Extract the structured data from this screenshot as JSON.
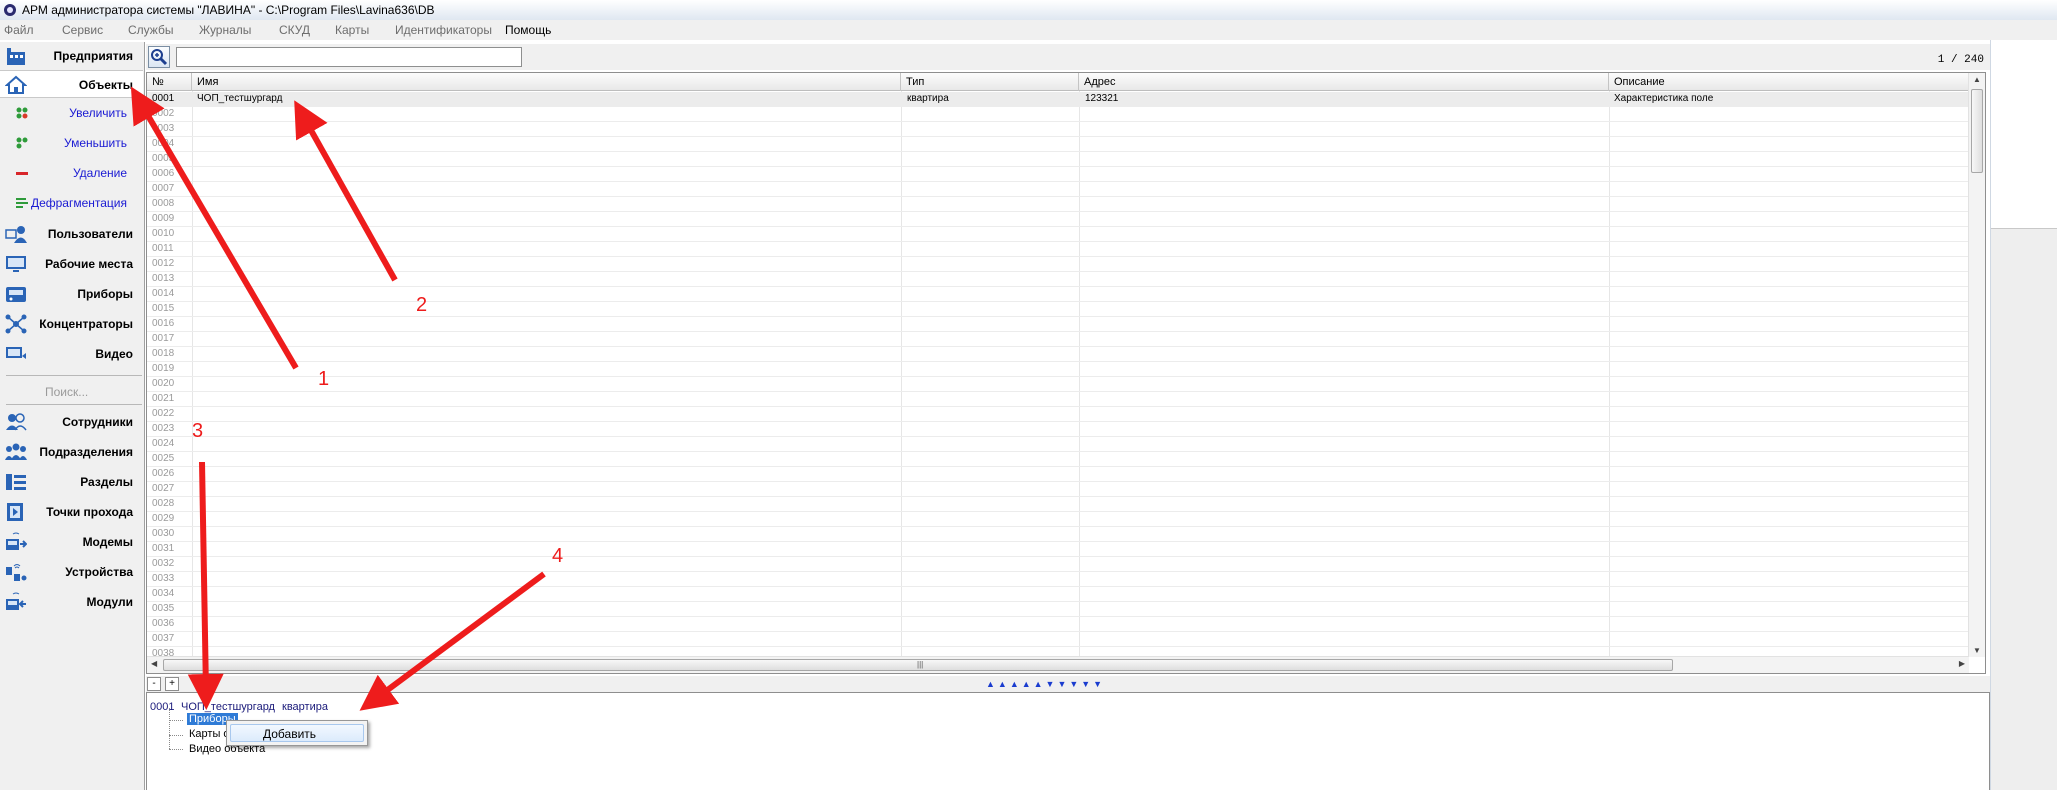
{
  "window": {
    "title": "АРМ администратора системы \"ЛАВИНА\" - C:\\Program Files\\Lavina636\\DB"
  },
  "menu": [
    "Файл",
    "Сервис",
    "Службы",
    "Журналы",
    "СКУД",
    "Карты",
    "Идентификаторы",
    "Помощь"
  ],
  "sidebar": {
    "items": [
      {
        "label": "Предприятия",
        "icon": "building-icon"
      },
      {
        "label": "Объекты",
        "icon": "house-icon",
        "selected": true
      },
      {
        "label": "Пользователи",
        "icon": "user-icon"
      },
      {
        "label": "Рабочие места",
        "icon": "monitor-icon"
      },
      {
        "label": "Приборы",
        "icon": "device-icon"
      },
      {
        "label": "Концентраторы",
        "icon": "hub-icon"
      },
      {
        "label": "Видео",
        "icon": "video-icon"
      }
    ],
    "sub_items": [
      {
        "label": "Увеличить",
        "icon": "green-dots-icon"
      },
      {
        "label": "Уменьшить",
        "icon": "reduce-dots-icon"
      },
      {
        "label": "Удаление",
        "icon": "delete-dash-icon"
      },
      {
        "label": "Дефрагментация",
        "icon": "defrag-lines-icon"
      }
    ],
    "search_label": "Поиск...",
    "search_items": [
      {
        "label": "Сотрудники",
        "icon": "employees-icon"
      },
      {
        "label": "Подразделения",
        "icon": "departments-icon"
      },
      {
        "label": "Разделы",
        "icon": "sections-icon"
      },
      {
        "label": "Точки прохода",
        "icon": "access-point-icon"
      },
      {
        "label": "Модемы",
        "icon": "modem-icon"
      },
      {
        "label": "Устройства",
        "icon": "devices-icon"
      },
      {
        "label": "Модули",
        "icon": "modules-icon"
      }
    ]
  },
  "toolbar": {
    "filter_value": "",
    "counter": "1 / 240"
  },
  "grid": {
    "columns": [
      "№",
      "Имя",
      "Тип",
      "Адрес",
      "Описание"
    ],
    "rows": [
      {
        "num": "0001",
        "name": "ЧОП_тестшургард",
        "type": "квартира",
        "address": "123321",
        "description": "Характеристика поле"
      }
    ],
    "empty_row_numbers": [
      "0002",
      "0003",
      "0004",
      "0005",
      "0006",
      "0007",
      "0008",
      "0009",
      "0010",
      "0011",
      "0012",
      "0013",
      "0014",
      "0015",
      "0016",
      "0017",
      "0018",
      "0019",
      "0020",
      "0021",
      "0022",
      "0023",
      "0024",
      "0025",
      "0026",
      "0027",
      "0028",
      "0029",
      "0030",
      "0031",
      "0032",
      "0033",
      "0034",
      "0035",
      "0036",
      "0037",
      "0038"
    ]
  },
  "tree": {
    "collapse_label": "-",
    "expand_label": "+",
    "indicator": "▲▲▲▲▲▼▼▼▼▼",
    "root": {
      "num": "0001",
      "name": "ЧОП_тестшургард",
      "type": "квартира"
    },
    "children": [
      "Приборы",
      "Карты объекта",
      "Видео объекта"
    ]
  },
  "context_menu": {
    "items": [
      "Добавить"
    ]
  },
  "annotations": {
    "color": "#ee1c1c",
    "labels": [
      "1",
      "2",
      "3",
      "4"
    ]
  }
}
